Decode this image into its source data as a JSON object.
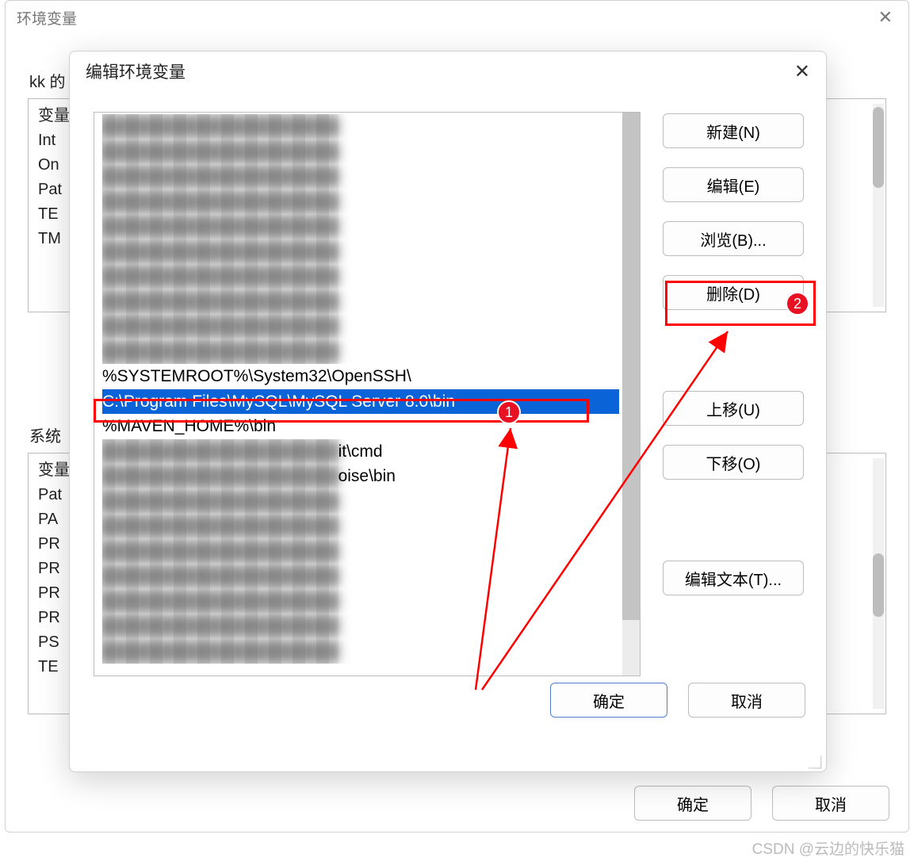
{
  "parent": {
    "title": "环境变量",
    "close_glyph": "✕",
    "user_section_label": "kk 的",
    "sys_section_label": "系统",
    "user_vars_header": "变量",
    "user_var_rows": [
      "Int",
      "On",
      "Pat",
      "TE",
      "TM"
    ],
    "sys_vars_header": "变量",
    "sys_var_rows": [
      "Pat",
      "PA",
      "PR",
      "PR",
      "PR",
      "PR",
      "PS",
      "TE"
    ],
    "ok_label": "确定",
    "cancel_label": "取消"
  },
  "child": {
    "title": "编辑环境变量",
    "close_glyph": "✕",
    "paths": {
      "redacted_before": 10,
      "visible1": "%SYSTEMROOT%\\System32\\OpenSSH\\",
      "selected": "C:\\Program Files\\MySQL\\MySQL Server 8.0\\bin",
      "visible2": "%MAVEN_HOME%\\bin",
      "visible3_tail": "it\\cmd",
      "visible4_tail": "oise\\bin",
      "redacted_after": 7
    },
    "buttons": {
      "new": "新建(N)",
      "edit": "编辑(E)",
      "browse": "浏览(B)...",
      "delete": "删除(D)",
      "move_up": "上移(U)",
      "move_down": "下移(O)",
      "edit_text": "编辑文本(T)..."
    },
    "ok_label": "确定",
    "cancel_label": "取消"
  },
  "annotations": {
    "badge1": "1",
    "badge2": "2"
  },
  "watermark": "CSDN @云边的快乐猫"
}
